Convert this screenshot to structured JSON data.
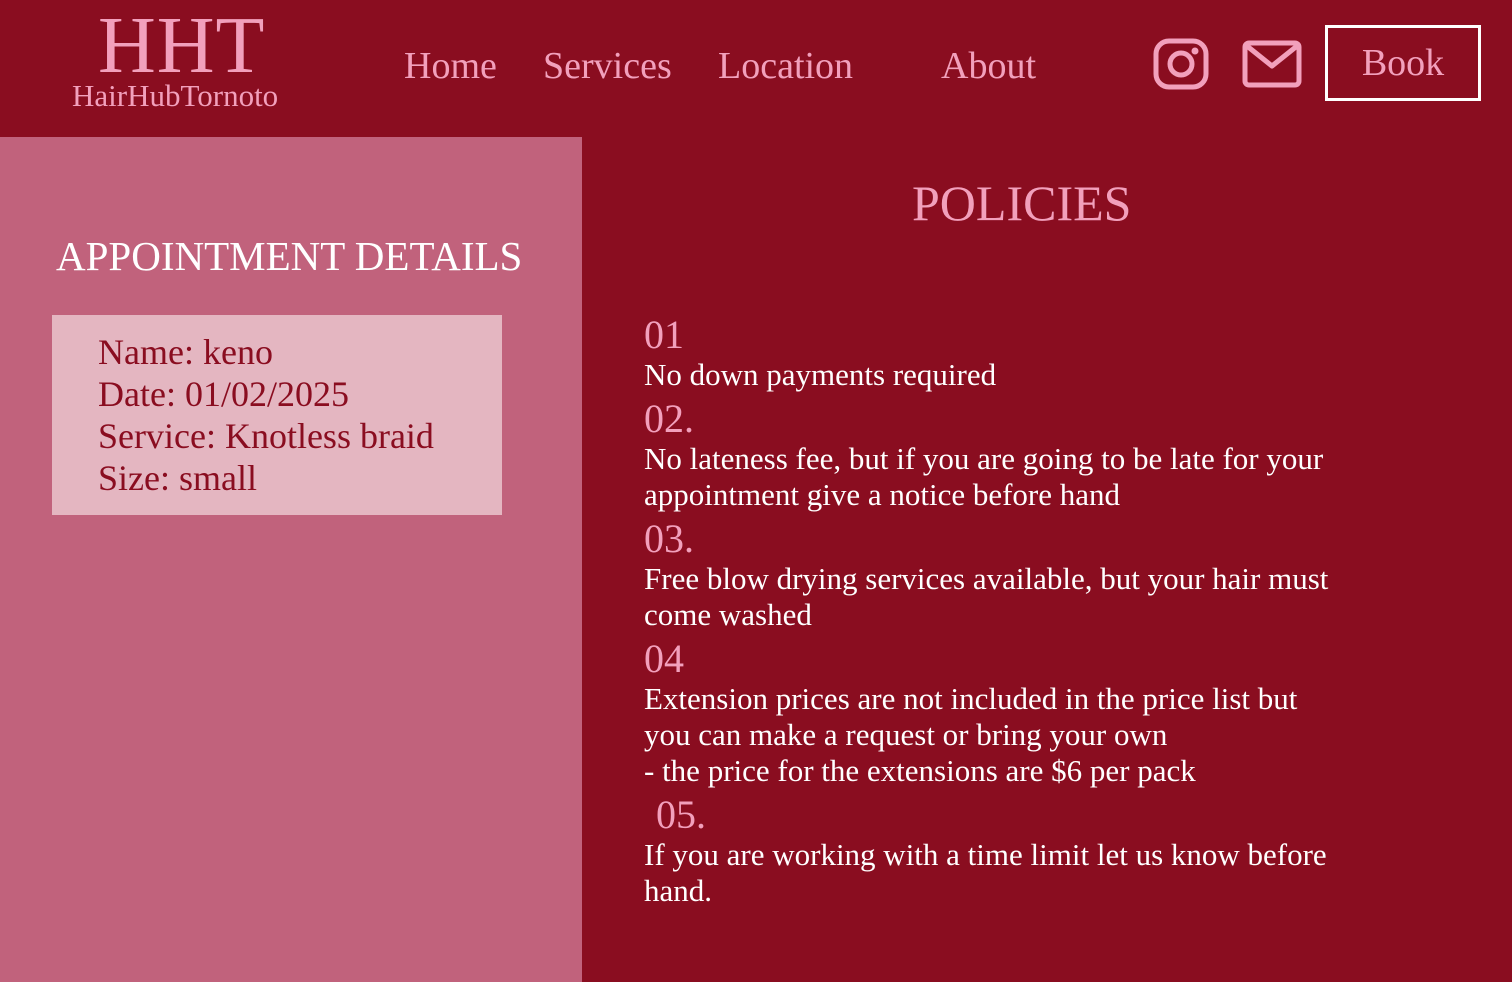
{
  "header": {
    "logo_mark": "HHT",
    "logo_name": "HairHubTornoto",
    "nav": [
      "Home",
      "Services",
      "Location",
      "About"
    ],
    "icons": [
      "instagram-icon",
      "mail-icon"
    ],
    "book_label": "Book"
  },
  "appointment": {
    "title": "APPOINTMENT DETAILS",
    "lines": [
      "Name: keno",
      "Date: 01/02/2025",
      "Service: Knotless braid",
      "Size: small"
    ]
  },
  "policies": {
    "title": "POLICIES",
    "items": [
      {
        "num": "01",
        "lines": [
          "No down payments required"
        ]
      },
      {
        "num": "02.",
        "lines": [
          "No lateness fee, but if you are going to be late for your",
          "appointment give a notice before hand"
        ]
      },
      {
        "num": "03.",
        "lines": [
          "Free blow drying services available, but your hair must",
          "come washed"
        ]
      },
      {
        "num": "04",
        "lines": [
          "Extension prices are not included in the price list but",
          "you can make a request or bring your own",
          "- the price for the extensions are $6 per pack"
        ]
      },
      {
        "num": "05.",
        "lines": [
          "If you are working with a time limit let us know before",
          "hand."
        ]
      }
    ]
  },
  "colors": {
    "background": "#8a0d20",
    "panel": "#c1627c",
    "card": "#e4b6c1",
    "accent": "#f2a0bc",
    "text": "#ffffff"
  }
}
